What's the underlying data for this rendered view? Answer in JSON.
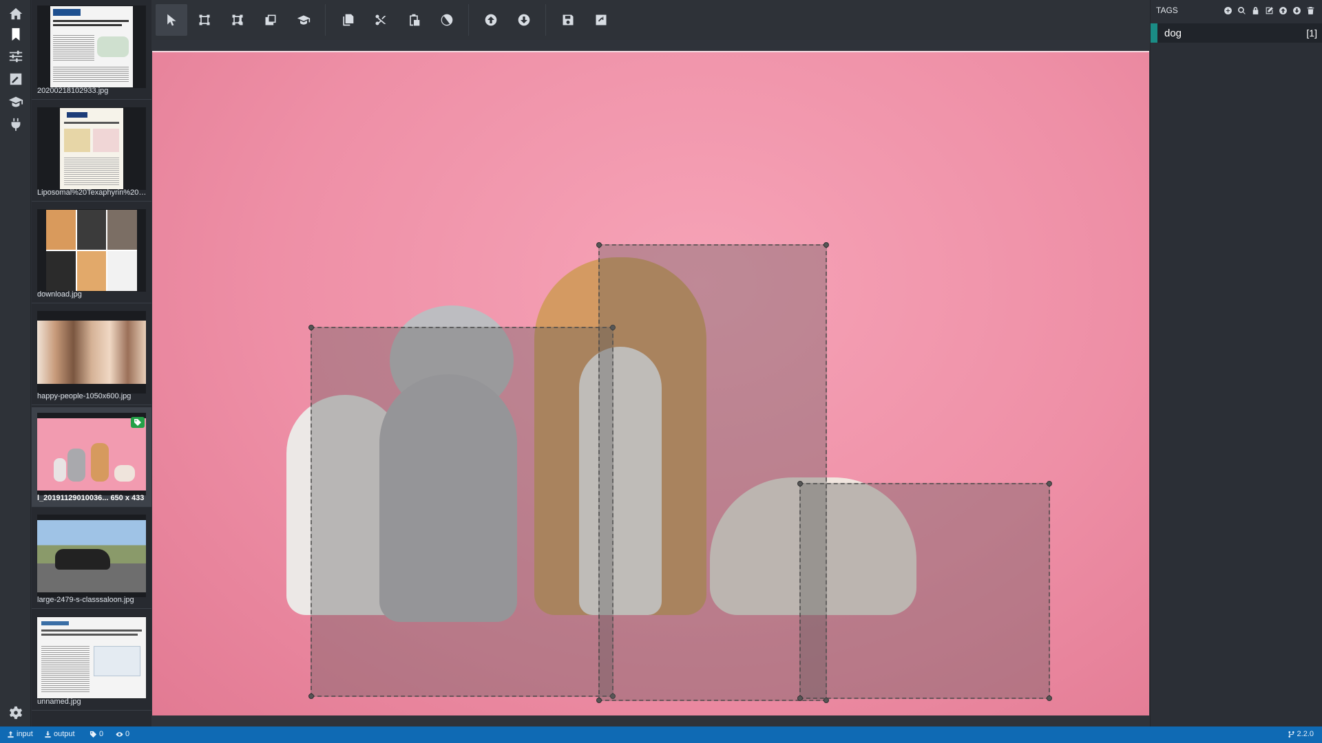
{
  "rail": {
    "items": [
      {
        "name": "home-icon"
      },
      {
        "name": "bookmark-icon",
        "active": true
      },
      {
        "name": "sliders-icon"
      },
      {
        "name": "edit-image-icon"
      },
      {
        "name": "graduation-cap-icon"
      },
      {
        "name": "plug-icon"
      }
    ],
    "settings": "gear-icon"
  },
  "thumbnails": [
    {
      "label": "20200218102933.jpg",
      "kind": "paper"
    },
    {
      "label": "Liposomal%20Texaphyrin%20T...",
      "kind": "paper"
    },
    {
      "label": "download.jpg",
      "kind": "dogs"
    },
    {
      "label": "happy-people-1050x600.jpg",
      "kind": "people"
    },
    {
      "label": "l_20191129010036...   650 x 433",
      "kind": "pets",
      "active": true,
      "tagged": true
    },
    {
      "label": "large-2479-s-classsaloon.jpg",
      "kind": "car"
    },
    {
      "label": "unnamed.jpg",
      "kind": "paper"
    }
  ],
  "toolbar": {
    "tools": [
      "pointer-icon",
      "rectangle-icon",
      "polygon-icon",
      "copy-rectangle-icon",
      "active-learning-icon",
      "copy-icon",
      "cut-icon",
      "paste-icon",
      "clear-icon",
      "previous-asset-icon",
      "next-asset-icon",
      "save-icon",
      "export-icon"
    ]
  },
  "tags_panel": {
    "title": "TAGS",
    "toolbar_icons": [
      "add-tag-icon",
      "search-tag-icon",
      "lock-tag-icon",
      "edit-tag-icon",
      "move-up-icon",
      "move-down-icon",
      "delete-tag-icon"
    ],
    "tags": [
      {
        "name": "dog",
        "count": "[1]",
        "color": "#1a8c85"
      }
    ]
  },
  "statusbar": {
    "input": "input",
    "output": "output",
    "tag_count": "0",
    "visited_count": "0",
    "version": "2.2.0"
  }
}
